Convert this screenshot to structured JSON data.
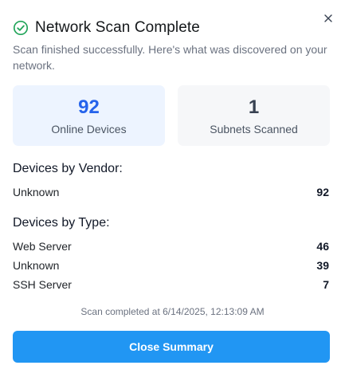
{
  "dialog": {
    "title": "Network Scan Complete",
    "subtitle": "Scan finished successfully. Here's what was discovered on your network.",
    "icons": {
      "header": "check-circle-icon",
      "close": "close-icon"
    }
  },
  "stats": {
    "online_devices": {
      "value": "92",
      "label": "Online Devices"
    },
    "subnets_scanned": {
      "value": "1",
      "label": "Subnets Scanned"
    }
  },
  "vendor_section": {
    "title": "Devices by Vendor:",
    "rows": [
      {
        "label": "Unknown",
        "count": "92"
      }
    ]
  },
  "type_section": {
    "title": "Devices by Type:",
    "rows": [
      {
        "label": "Web Server",
        "count": "46"
      },
      {
        "label": "Unknown",
        "count": "39"
      },
      {
        "label": "SSH Server",
        "count": "7"
      }
    ]
  },
  "footer": {
    "completed_text": "Scan completed at 6/14/2025, 12:13:09 AM",
    "close_summary_label": "Close Summary"
  },
  "colors": {
    "success": "#22a55a",
    "accent": "#2196f3",
    "stat_primary": "#2563eb"
  }
}
